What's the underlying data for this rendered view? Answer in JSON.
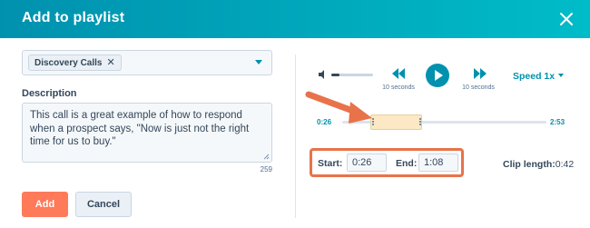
{
  "modal": {
    "title": "Add to playlist"
  },
  "playlist_select": {
    "selected_tag": "Discovery Calls",
    "tag_remove": "✕"
  },
  "description": {
    "label": "Description",
    "value": "This call is a great example of how to respond when a prospect says, \"Now is just not the right time for us to buy.\"",
    "char_count": "259"
  },
  "buttons": {
    "add_label": "Add",
    "cancel_label": "Cancel"
  },
  "player": {
    "volume_level": 0.2,
    "rewind_label": "10 seconds",
    "forward_label": "10 seconds",
    "speed_label": "Speed 1x",
    "current_time": "0:26",
    "total_time": "2:53"
  },
  "clip": {
    "start_label": "Start:",
    "start_value": "0:26",
    "end_label": "End:",
    "end_value": "1:08",
    "length_label": "Clip length:",
    "length_value": "0:42"
  },
  "colors": {
    "header_gradient_start": "#0091ae",
    "header_gradient_end": "#00bcc8",
    "accent": "#0091ae",
    "primary_button": "#ff7a59",
    "annotation": "#e8734a",
    "clip_fill": "#fde8c5"
  },
  "icons": {
    "close": "close-icon",
    "volume": "volume-icon",
    "rewind": "rewind-icon",
    "play": "play-icon",
    "forward": "fast-forward-icon",
    "annotation_arrow": "arrow-icon"
  }
}
